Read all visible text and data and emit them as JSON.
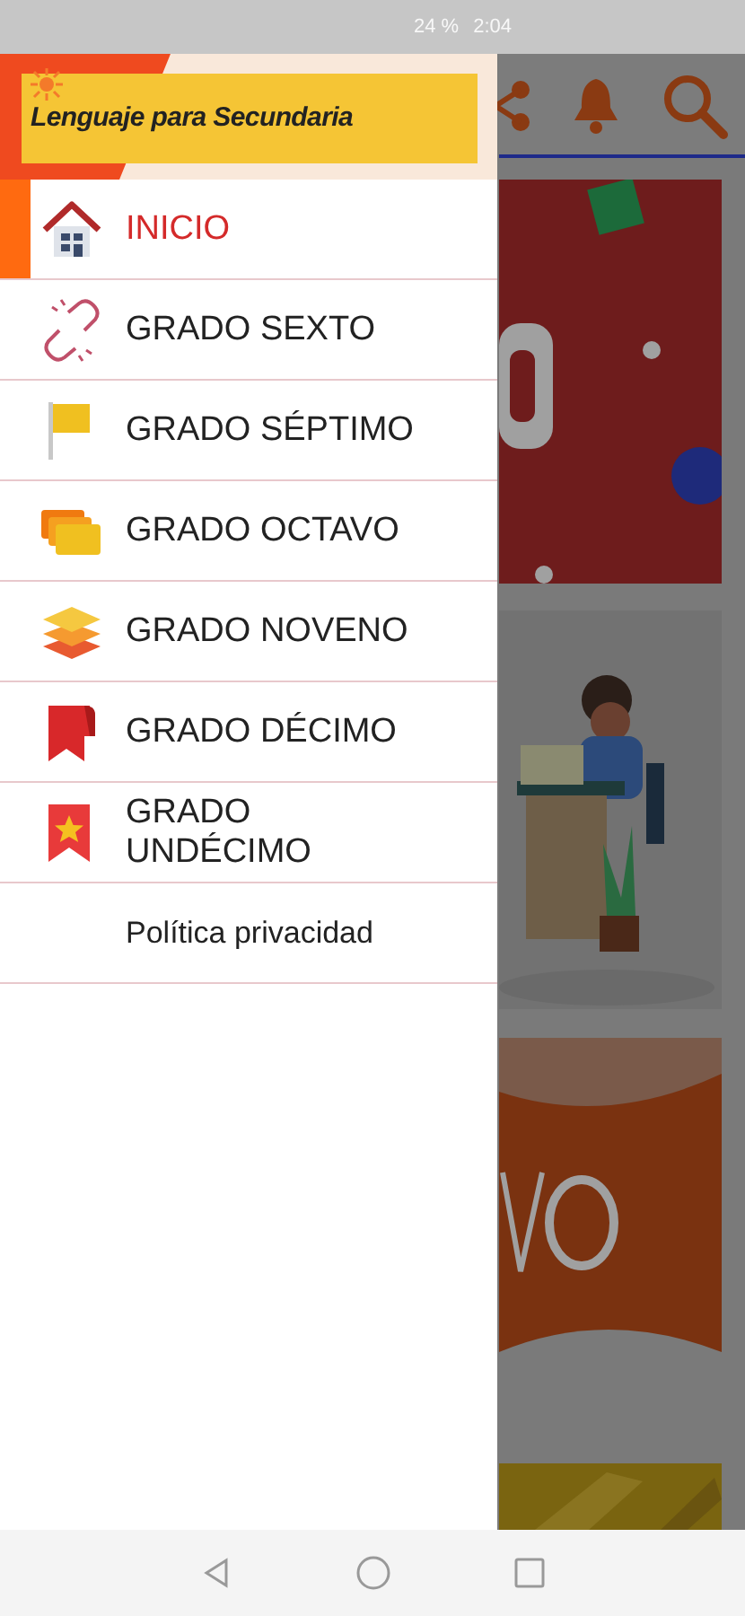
{
  "status_bar": {
    "battery": "24 %",
    "time": "2:04"
  },
  "drawer": {
    "title": "Lenguaje para Secundaria",
    "items": [
      {
        "label": "INICIO",
        "selected": true
      },
      {
        "label": "GRADO SEXTO",
        "selected": false
      },
      {
        "label": "GRADO SÉPTIMO",
        "selected": false
      },
      {
        "label": "GRADO OCTAVO",
        "selected": false
      },
      {
        "label": "GRADO NOVENO",
        "selected": false
      },
      {
        "label": "GRADO DÉCIMO",
        "selected": false
      },
      {
        "label": "GRADO UNDÉCIMO",
        "selected": false
      },
      {
        "label": "Política privacidad",
        "selected": false
      }
    ]
  }
}
